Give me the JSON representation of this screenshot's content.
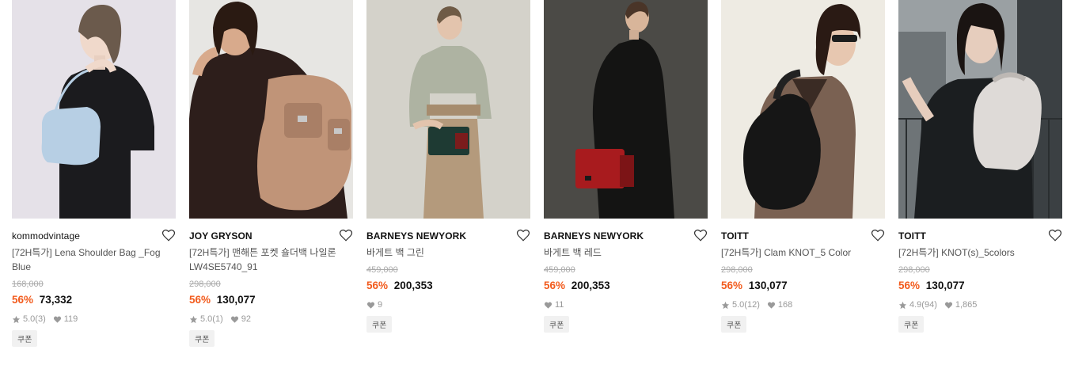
{
  "products": [
    {
      "brand": "kommodvintage",
      "title": "[72H특가] Lena Shoulder Bag _Fog Blue",
      "original_price": "168,000",
      "discount": "56%",
      "price": "73,332",
      "rating": "5.0",
      "reviews": "(3)",
      "likes": "119",
      "badge": "쿠폰"
    },
    {
      "brand": "JOY GRYSON",
      "title": "[72H특가] 맨해튼 포켓 숄더백 나일론 LW4SE5740_91",
      "original_price": "298,000",
      "discount": "56%",
      "price": "130,077",
      "rating": "5.0",
      "reviews": "(1)",
      "likes": "92",
      "badge": "쿠폰"
    },
    {
      "brand": "BARNEYS NEWYORK",
      "title": "바게트 백 그린",
      "original_price": "459,000",
      "discount": "56%",
      "price": "200,353",
      "likes": "9",
      "badge": "쿠폰"
    },
    {
      "brand": "BARNEYS NEWYORK",
      "title": "바게트 백 레드",
      "original_price": "459,000",
      "discount": "56%",
      "price": "200,353",
      "likes": "11",
      "badge": "쿠폰"
    },
    {
      "brand": "TOITT",
      "title": "[72H특가] Clam KNOT_5 Color",
      "original_price": "298,000",
      "discount": "56%",
      "price": "130,077",
      "rating": "5.0",
      "reviews": "(12)",
      "likes": "168",
      "badge": "쿠폰"
    },
    {
      "brand": "TOITT",
      "title": "[72H특가] KNOT(s)_5colors",
      "original_price": "298,000",
      "discount": "56%",
      "price": "130,077",
      "rating": "4.9",
      "reviews": "(94)",
      "likes": "1,865",
      "badge": "쿠폰"
    }
  ],
  "colors": {
    "discount": "#f25b1d",
    "muted": "#999999"
  },
  "icons": {
    "wishlist": "heart-outline-icon",
    "rating": "star-icon",
    "likes": "heart-icon"
  }
}
